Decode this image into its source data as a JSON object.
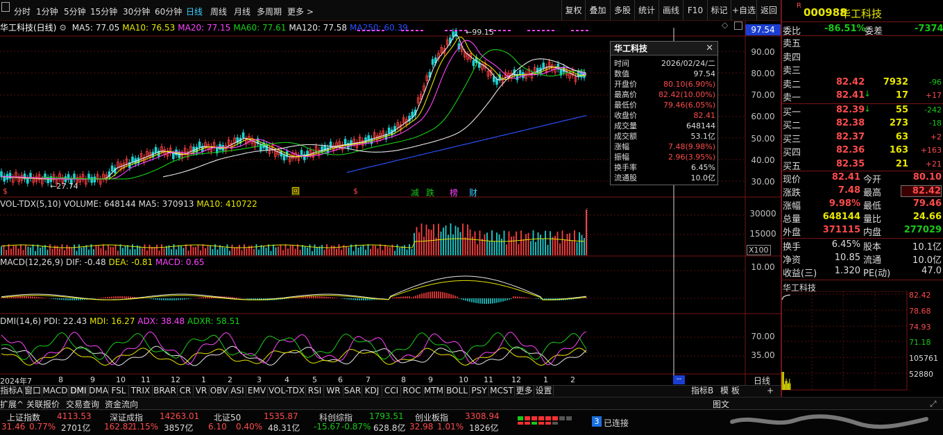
{
  "toolbar": {
    "items": [
      "分时",
      "1分钟",
      "5分钟",
      "15分钟",
      "30分钟",
      "60分钟",
      "日线",
      "周线",
      "月线",
      "多周期",
      "更多 >"
    ],
    "right": [
      "复权",
      "叠加",
      "多股",
      "统计",
      "画线",
      "F10",
      "标记",
      "+自选",
      "返回"
    ]
  },
  "chart": {
    "title": "华工科技(日线)",
    "ma": [
      {
        "t": "MA5: 77.05",
        "c": "#e8e8e8"
      },
      {
        "t": "MA10: 76.53",
        "c": "#e8e800"
      },
      {
        "t": "MA20: 77.15",
        "c": "#ff44ff"
      },
      {
        "t": "MA60: 77.61",
        "c": "#18d018"
      },
      {
        "t": "MA120: 77.58",
        "c": "#e8e8e8"
      },
      {
        "t": "MA250: 60.39",
        "c": "#2a50ff"
      }
    ],
    "current_tag": "97.54",
    "high_label": "99.15",
    "low_label": "27.74",
    "y_ticks": [
      "90.00",
      "80.00",
      "70.00",
      "60.00",
      "50.00",
      "40.00",
      "30.00"
    ],
    "markers": [
      "回",
      "$",
      "减",
      "跌",
      "榜",
      "财"
    ]
  },
  "tooltip": {
    "title": "华工科技",
    "rows": [
      [
        "时间",
        "2026/02/24/二"
      ],
      [
        "数值",
        "97.54"
      ],
      [
        "开盘价",
        "80.10(6.90%)"
      ],
      [
        "最高价",
        "82.42(10.00%)"
      ],
      [
        "最低价",
        "79.46(6.05%)"
      ],
      [
        "收盘价",
        "82.41"
      ],
      [
        "成交量",
        "648144"
      ],
      [
        "成交额",
        "53.1亿"
      ],
      [
        "涨幅",
        "7.48(9.98%)"
      ],
      [
        "振幅",
        "2.96(3.95%)"
      ],
      [
        "换手率",
        "6.45%"
      ],
      [
        "流通股",
        "10.0亿"
      ]
    ]
  },
  "vol": {
    "label": "VOL-TDX(5,10)",
    "volume": "VOLUME: 648144",
    "ma5": "MA5: 370913",
    "ma10": "MA10: 410722",
    "ticks": [
      "30000",
      "15000"
    ],
    "unit": "X100"
  },
  "macd": {
    "label": "MACD(12,26,9)",
    "dif": "DIF: -0.48",
    "dea": "DEA: -0.81",
    "macd": "MACD: 0.65",
    "tick": "10.00"
  },
  "dmi": {
    "label": "DMI(14,6)",
    "pdi": "PDI: 22.43",
    "mdi": "MDI: 16.27",
    "adx": "ADX: 38.48",
    "adxr": "ADXR: 58.51",
    "ticks": [
      "70.00",
      "35.00"
    ]
  },
  "xaxis": {
    "labels": [
      "2024年7",
      "8",
      "9",
      "10",
      "11",
      "12",
      "1",
      "2",
      "3",
      "4",
      "5",
      "6",
      "7",
      "8",
      "9",
      "10",
      "11",
      "12",
      "1",
      "2"
    ],
    "period": "日线",
    "cursor": "--"
  },
  "tabs": [
    "指标A",
    "窗口",
    "MACD",
    "DMI",
    "DMA",
    "FSL",
    "TRIX",
    "BRAR",
    "CR",
    "VR",
    "OBV",
    "ASI",
    "EMV",
    "VOL-TDX",
    "RSI",
    "WR",
    "SAR",
    "KDJ",
    "CCI",
    "ROC",
    "MTM",
    "BOLL",
    "PSY",
    "MCST",
    "更多",
    "设置"
  ],
  "tabs_right": [
    "指标B",
    "模 板",
    "+",
    "-"
  ],
  "tabs2": [
    "扩展^",
    "关联报价",
    "交易查询",
    "资金流向"
  ],
  "quote": {
    "r": "R",
    "code": "000988",
    "name": "华工科技",
    "wb_label": "委比",
    "wb": "-86.51%",
    "wc_label": "委差",
    "wc": "-7374",
    "sell": [
      {
        "l": "卖五",
        "p": "",
        "v": "",
        "d": ""
      },
      {
        "l": "卖四",
        "p": "",
        "v": "",
        "d": ""
      },
      {
        "l": "卖三",
        "p": "",
        "v": "",
        "d": ""
      },
      {
        "l": "卖二",
        "p": "82.42",
        "v": "7932",
        "d": "-96"
      },
      {
        "l": "卖一",
        "p": "82.41",
        "v": "17",
        "d": "+17"
      }
    ],
    "buy": [
      {
        "l": "买一",
        "p": "82.39",
        "v": "55",
        "d": "-242"
      },
      {
        "l": "买二",
        "p": "82.38",
        "v": "273",
        "d": "-18"
      },
      {
        "l": "买三",
        "p": "82.37",
        "v": "63",
        "d": "+2"
      },
      {
        "l": "买四",
        "p": "82.36",
        "v": "163",
        "d": "+163"
      },
      {
        "l": "买五",
        "p": "82.35",
        "v": "21",
        "d": "+21"
      }
    ],
    "stats": [
      [
        "现价",
        "82.41",
        "今开",
        "80.10"
      ],
      [
        "涨跌",
        "7.48",
        "最高",
        "82.42"
      ],
      [
        "涨幅",
        "9.98%",
        "最低",
        "79.46"
      ],
      [
        "总量",
        "648144",
        "量比",
        "24.66"
      ],
      [
        "外盘",
        "371115",
        "内盘",
        "277029"
      ]
    ],
    "stats2": [
      [
        "换手",
        "6.45%",
        "股本",
        "10.1亿"
      ],
      [
        "净资",
        "10.85",
        "流通",
        "10.0亿"
      ],
      [
        "收益(三)",
        "1.320",
        "PE(动)",
        "47.0"
      ]
    ],
    "mini_title": "华工科技",
    "mini_ticks": [
      "82.42",
      "78.68",
      "74.93",
      "71.18",
      "105761",
      "52880"
    ]
  },
  "status": {
    "idx": [
      {
        "n": "上证指数",
        "v": "4113.53",
        "c": "31.46",
        "p": "0.77%",
        "a": "2701亿",
        "col": "red"
      },
      {
        "n": "深证成指",
        "v": "14263.01",
        "c": "162.82",
        "p": "1.15%",
        "a": "3857亿",
        "col": "red"
      },
      {
        "n": "北证50",
        "v": "1535.87",
        "c": "6.10",
        "p": "0.40%",
        "a": "48.31亿",
        "col": "red"
      },
      {
        "n": "科创综指",
        "v": "1793.51",
        "c": "-15.67",
        "p": "-0.87%",
        "a": "628.8亿",
        "col": "grn"
      },
      {
        "n": "创业板指",
        "v": "3308.94",
        "c": "32.98",
        "p": "1.01%",
        "a": "1826亿",
        "col": "red"
      }
    ],
    "conn_num": "3",
    "conn": "已连接",
    "tuwen": "图文"
  }
}
